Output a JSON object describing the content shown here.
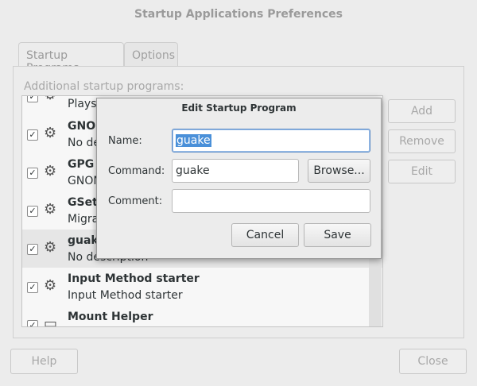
{
  "window": {
    "title": "Startup Applications Preferences"
  },
  "tabs": [
    {
      "label": "Startup Programs"
    },
    {
      "label": "Options"
    }
  ],
  "section_label": "Additional startup programs:",
  "programs": [
    {
      "name": "",
      "desc": "Plays",
      "checked": true
    },
    {
      "name": "GNOI",
      "desc": "No de",
      "checked": true
    },
    {
      "name": "GPG I",
      "desc": "GNON",
      "checked": true
    },
    {
      "name": "GSett",
      "desc": "Migra",
      "checked": true
    },
    {
      "name": "guake",
      "desc": "No description",
      "checked": true
    },
    {
      "name": "Input Method starter",
      "desc": "Input Method starter",
      "checked": true
    },
    {
      "name": "Mount Helper",
      "desc": "",
      "checked": true
    }
  ],
  "side_buttons": {
    "add": "Add",
    "remove": "Remove",
    "edit": "Edit"
  },
  "bottom_buttons": {
    "help": "Help",
    "close": "Close"
  },
  "dialog": {
    "title": "Edit Startup Program",
    "name_label": "Name:",
    "name_value": "guake",
    "command_label": "Command:",
    "command_value": "guake",
    "browse_label": "Browse...",
    "comment_label": "Comment:",
    "comment_value": "",
    "cancel_label": "Cancel",
    "save_label": "Save"
  },
  "icons": {
    "program": "gear-icon",
    "drive": "drive-icon",
    "check": "check-icon"
  }
}
